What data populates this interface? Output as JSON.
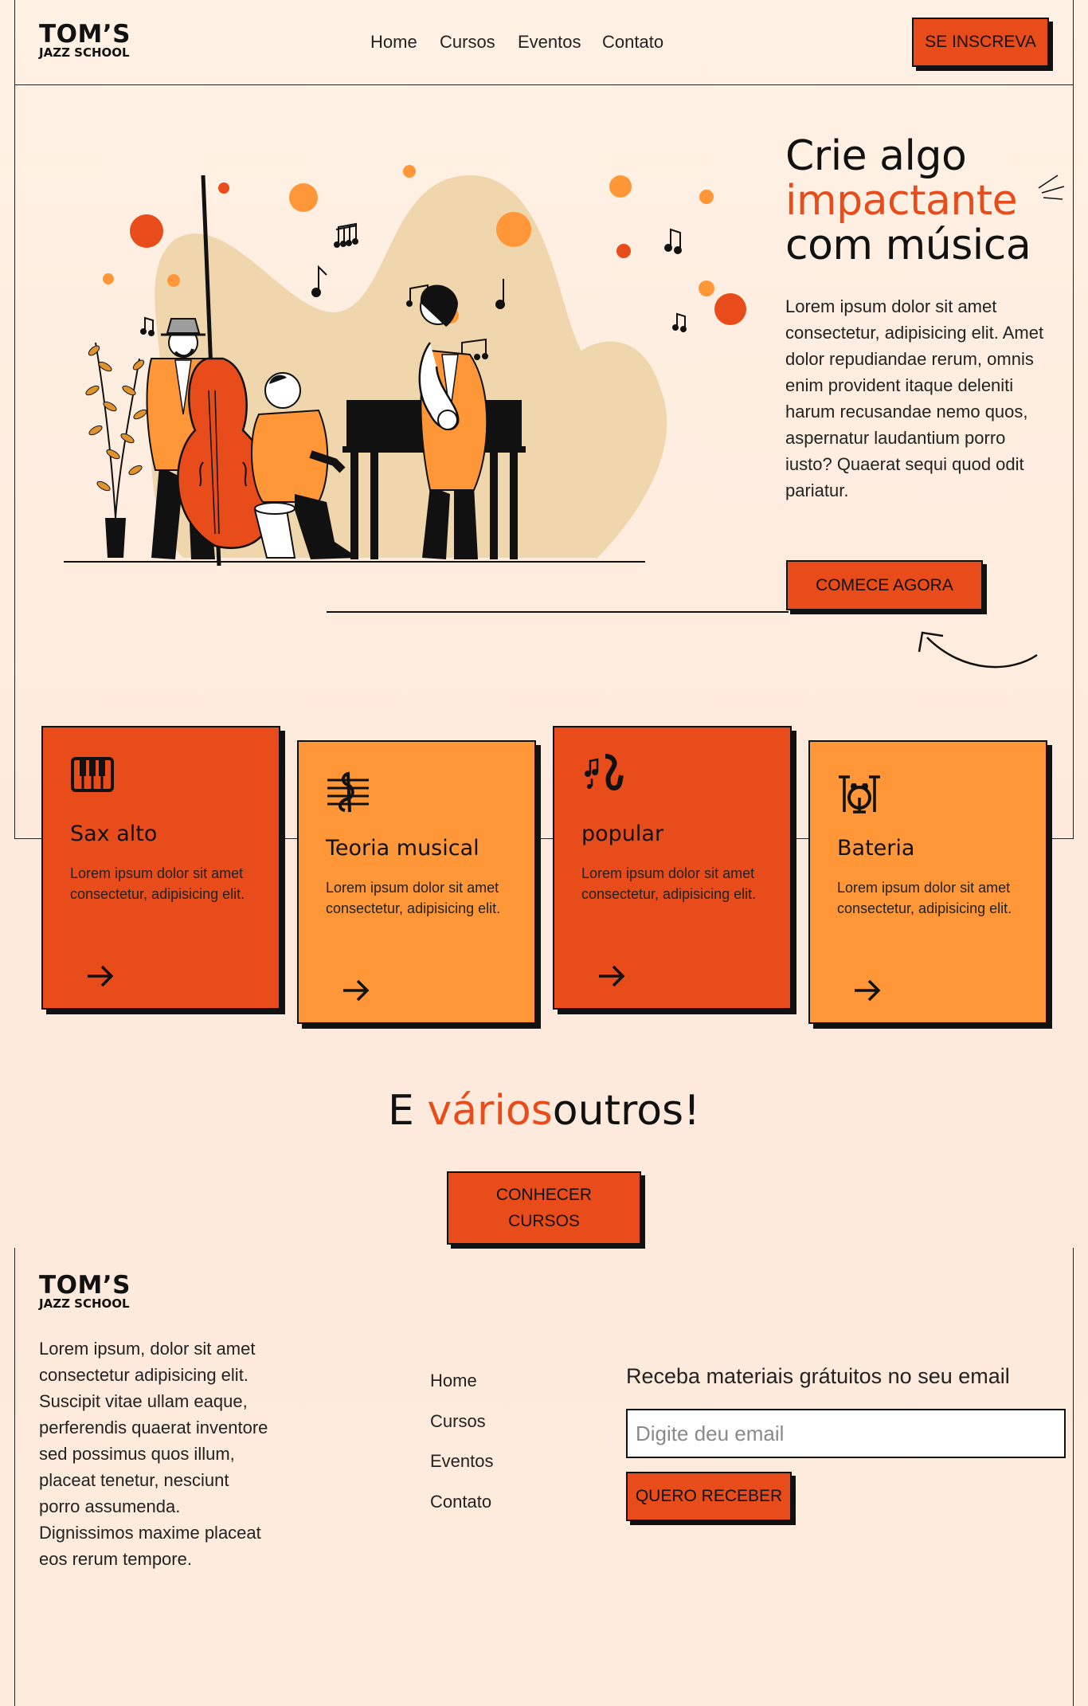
{
  "header": {
    "logo_main": "TOM’S",
    "logo_sub": "JAZZ SCHOOL",
    "nav": [
      "Home",
      "Cursos",
      "Eventos",
      "Contato"
    ],
    "cta": "SE INSCREVA"
  },
  "hero": {
    "title_line1": "Crie algo",
    "title_accent": "impactante",
    "title_line3": "com música",
    "text": "Lorem ipsum dolor sit amet consectetur, adipisicing elit. Amet dolor repudiandae rerum, omnis enim provident itaque deleniti harum recusandae nemo quos, aspernatur laudantium porro iusto? Quaerat sequi quod odit pariatur.",
    "cta": "COMECE AGORA"
  },
  "cards": [
    {
      "title": "Sax alto",
      "text": "Lorem ipsum dolor sit amet consectetur, adipisicing elit.",
      "icon": "piano-keys-icon"
    },
    {
      "title": "Teoria musical",
      "text": "Lorem ipsum dolor sit amet consectetur, adipisicing elit.",
      "icon": "treble-clef-staff-icon"
    },
    {
      "title": "popular",
      "text": "Lorem ipsum dolor sit amet consectetur, adipisicing elit.",
      "icon": "saxophone-notes-icon"
    },
    {
      "title": "Bateria",
      "text": "Lorem ipsum dolor sit amet consectetur, adipisicing elit.",
      "icon": "drum-kit-icon"
    }
  ],
  "outros": {
    "prefix": "E ",
    "accent": "vários",
    "suffix": "outros!",
    "cta": "CONHECER CURSOS"
  },
  "footer": {
    "logo_main": "TOM’S",
    "logo_sub": "JAZZ SCHOOL",
    "text": "Lorem ipsum, dolor sit amet consectetur adipisicing elit. Suscipit vitae ullam eaque, perferendis quaerat inventore sed possimus quos illum, placeat tenetur, nesciunt porro assumenda. Dignissimos maxime placeat eos rerum tempore.",
    "links": [
      "Home",
      "Cursos",
      "Eventos",
      "Contato"
    ],
    "newsletter_title": "Receba materiais grátuitos no seu email",
    "email_placeholder": "Digite deu email",
    "newsletter_cta": "QUERO RECEBER"
  },
  "colors": {
    "accent": "#e84c1a",
    "orange": "#ff9738",
    "background": "#fff1e4"
  }
}
